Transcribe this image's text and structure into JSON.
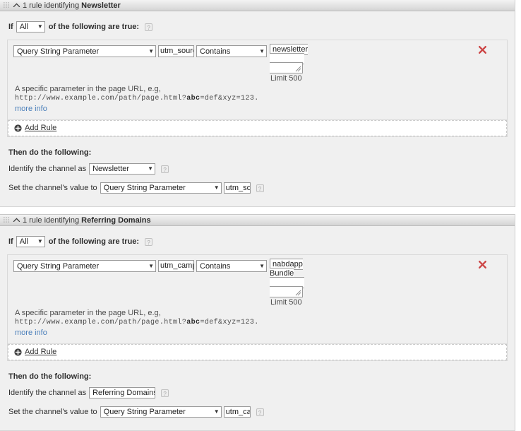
{
  "common": {
    "if_label": "If",
    "if_suffix": "of the following are true:",
    "all_option": "All",
    "caret_glyph": "▼",
    "collapse_glyph": "⌃",
    "help_glyph": "?",
    "add_rule_label": "Add Rule",
    "then_title": "Then do the following:",
    "identify_label": "Identify the channel as",
    "set_value_label": "Set the channel's value to",
    "limit_label": "Limit 500",
    "more_info_label": "more info",
    "desc_line1": "A specific parameter in the page URL, e.g,",
    "desc_line2_pre": "http://www.example.com/path/page.html?",
    "desc_line2_bold": "abc",
    "desc_line2_post": "=def&xyz=123.",
    "remove_glyph": "✖",
    "plus_glyph": "+",
    "condition_type": "Query String Parameter",
    "operator": "Contains"
  },
  "colors": {
    "panel_bg": "#f0f0f0",
    "header_gray": "#e4e4e4",
    "link_blue": "#4a7fba",
    "remove_red": "#cc4444",
    "field_border": "#9a9a9a"
  },
  "panels": [
    {
      "title_prefix": "1 rule identifying ",
      "title_strong": "Newsletter",
      "match_mode": "All",
      "rule": {
        "type": "Query String Parameter",
        "parameter": "utm_source",
        "operator": "Contains",
        "value": "newsletter",
        "limit": "Limit 500"
      },
      "then": {
        "channel": "Newsletter",
        "value_source": "Query String Parameter",
        "value_parameter": "utm_sou"
      }
    },
    {
      "title_prefix": "1 rule identifying ",
      "title_strong": "Referring Domains",
      "match_mode": "All",
      "rule": {
        "type": "Query String Parameter",
        "parameter": "utm_campa",
        "operator": "Contains",
        "value": "nabdapp\nBundle",
        "limit": "Limit 500"
      },
      "then": {
        "channel": "Referring Domains",
        "value_source": "Query String Parameter",
        "value_parameter": "utm_cam"
      }
    }
  ]
}
